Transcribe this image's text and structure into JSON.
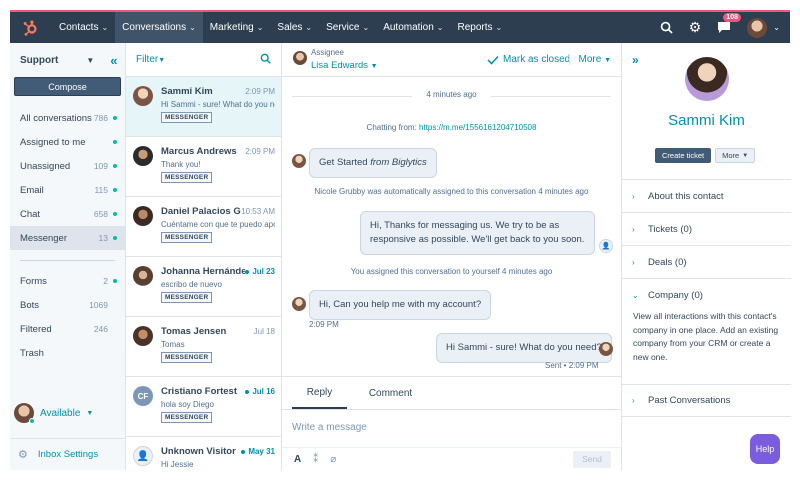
{
  "nav": {
    "items": [
      {
        "label": "Contacts"
      },
      {
        "label": "Conversations"
      },
      {
        "label": "Marketing"
      },
      {
        "label": "Sales"
      },
      {
        "label": "Service"
      },
      {
        "label": "Automation"
      },
      {
        "label": "Reports"
      }
    ],
    "notifications": "108",
    "icons": [
      "hubspot-logo-icon",
      "search-icon",
      "gear-icon",
      "notification-icon",
      "avatar"
    ],
    "accent": "#f2547d",
    "bg": "#2d3e50"
  },
  "sidebar": {
    "title": "Support",
    "compose": "Compose",
    "inboxes": [
      {
        "label": "All conversations",
        "count": "786",
        "dot": true
      },
      {
        "label": "Assigned to me",
        "count": "",
        "dot": true
      },
      {
        "label": "Unassigned",
        "count": "109",
        "dot": true
      },
      {
        "label": "Email",
        "count": "115",
        "dot": true
      },
      {
        "label": "Chat",
        "count": "658",
        "dot": true
      },
      {
        "label": "Messenger",
        "count": "13",
        "dot": true
      }
    ],
    "folders": [
      {
        "label": "Forms",
        "count": "2",
        "dot": true
      },
      {
        "label": "Bots",
        "count": "1069",
        "dot": false
      },
      {
        "label": "Filtered",
        "count": "246",
        "dot": false
      },
      {
        "label": "Trash",
        "count": "",
        "dot": false
      }
    ],
    "availability": "Available",
    "settings": "Inbox Settings"
  },
  "convlist": {
    "filter": "Filter",
    "items": [
      {
        "name": "Sammi Kim",
        "time": "2:09 PM",
        "preview": "Hi Sammi - sure! What do you nee...",
        "tag": "MESSENGER",
        "unread": false
      },
      {
        "name": "Marcus Andrews",
        "time": "2:09 PM",
        "preview": "Thank you!",
        "tag": "MESSENGER",
        "unread": false
      },
      {
        "name": "Daniel Palacios G...",
        "time": "10:53 AM",
        "preview": "Cuéntame con que te puedo apoyar",
        "tag": "MESSENGER",
        "unread": false
      },
      {
        "name": "Johanna Hernández",
        "time": "Jul 23",
        "preview": "escribo de nuevo",
        "tag": "MESSENGER",
        "unread": true
      },
      {
        "name": "Tomas Jensen",
        "time": "Jul 18",
        "preview": "Tomas",
        "tag": "MESSENGER",
        "unread": false
      },
      {
        "name": "Cristiano Fortest",
        "time": "Jul 16",
        "preview": "hola soy Diego",
        "tag": "MESSENGER",
        "unread": true,
        "initials": "CF"
      },
      {
        "name": "Unknown Visitor",
        "time": "May 31",
        "preview": "Hi Jessie",
        "tag": "",
        "unread": true
      }
    ]
  },
  "thread": {
    "assignee_label": "Assignee",
    "assignee": "Lisa Edwards",
    "mark_closed": "Mark as closed",
    "more": "More",
    "timestamp": "4 minutes ago",
    "chatting_from_prefix": "Chatting from:",
    "chatting_from_url": "https://m.me/1556161204710508",
    "bubble1_text": "Get Started",
    "bubble1_suffix": "from Biglytics",
    "system1": "Nicole Grubby was automatically assigned to this conversation 4 minutes ago",
    "bubble2": "Hi, Thanks for messaging us. We try to be as responsive as possible. We'll get back to you soon.",
    "system2": "You assigned this conversation to yourself 4 minutes ago",
    "bubble3": "Hi, Can you help me with my account?",
    "bubble3_time": "2:09 PM",
    "bubble4": "Hi Sammi - sure! What do you need?",
    "bubble4_meta": "Sent • 2:09 PM",
    "tabs": [
      {
        "label": "Reply"
      },
      {
        "label": "Comment"
      }
    ],
    "composer_placeholder": "Write a message",
    "tool_text": "A",
    "send": "Send"
  },
  "contact": {
    "name": "Sammi Kim",
    "create_ticket": "Create ticket",
    "more": "More",
    "sections": [
      {
        "label": "About this contact",
        "expanded": false
      },
      {
        "label": "Tickets (0)",
        "expanded": false
      },
      {
        "label": "Deals (0)",
        "expanded": false
      },
      {
        "label": "Company (0)",
        "expanded": true
      },
      {
        "label": "Past Conversations",
        "expanded": false
      }
    ],
    "company_desc": "View all interactions with this contact's company in one place. Add an existing company from your CRM or create a new one."
  },
  "help": "Help"
}
